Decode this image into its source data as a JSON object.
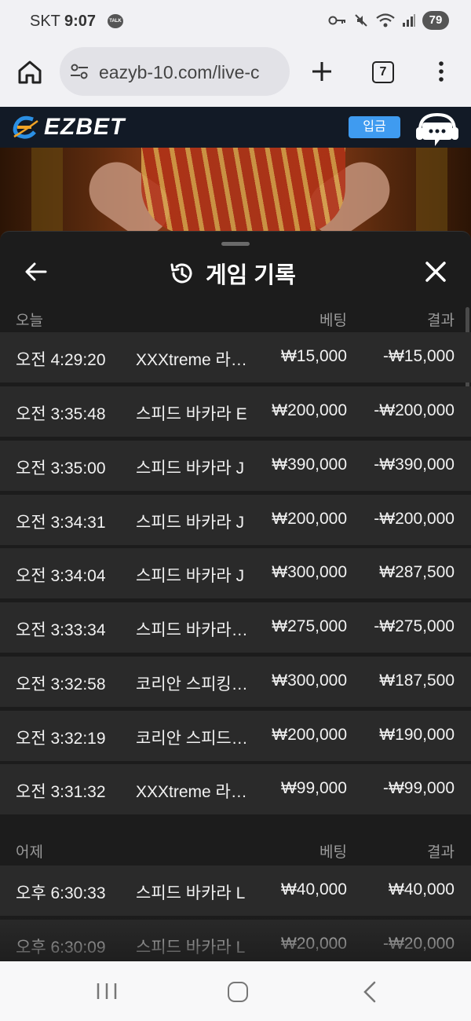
{
  "status_bar": {
    "carrier": "SKT",
    "time": "9:07",
    "talk_badge": "TALK",
    "battery": "79",
    "icons": [
      "key-icon",
      "mute-icon",
      "wifi-icon",
      "signal-icon",
      "battery-icon"
    ]
  },
  "browser": {
    "url": "eazyb-10.com/live-c",
    "tab_count": "7"
  },
  "site": {
    "logo_text": "EZBET",
    "deposit_label": "입금"
  },
  "panel": {
    "title": "게임 기록",
    "sections": [
      {
        "label": "오늘",
        "bet_header": "베팅",
        "result_header": "결과",
        "rows": [
          {
            "time": "오전 4:29:20",
            "game": "XXXtreme 라…",
            "bet": "₩15,000",
            "result": "-₩15,000"
          },
          {
            "time": "오전 3:35:48",
            "game": "스피드 바카라 E",
            "bet": "₩200,000",
            "result": "-₩200,000"
          },
          {
            "time": "오전 3:35:00",
            "game": "스피드 바카라 J",
            "bet": "₩390,000",
            "result": "-₩390,000"
          },
          {
            "time": "오전 3:34:31",
            "game": "스피드 바카라 J",
            "bet": "₩200,000",
            "result": "-₩200,000"
          },
          {
            "time": "오전 3:34:04",
            "game": "스피드 바카라 J",
            "bet": "₩300,000",
            "result": "₩287,500"
          },
          {
            "time": "오전 3:33:34",
            "game": "스피드 바카라…",
            "bet": "₩275,000",
            "result": "-₩275,000"
          },
          {
            "time": "오전 3:32:58",
            "game": "코리안 스피킹…",
            "bet": "₩300,000",
            "result": "₩187,500"
          },
          {
            "time": "오전 3:32:19",
            "game": "코리안 스피드…",
            "bet": "₩200,000",
            "result": "₩190,000"
          },
          {
            "time": "오전 3:31:32",
            "game": "XXXtreme 라…",
            "bet": "₩99,000",
            "result": "-₩99,000"
          }
        ]
      },
      {
        "label": "어제",
        "bet_header": "베팅",
        "result_header": "결과",
        "rows": [
          {
            "time": "오후 6:30:33",
            "game": "스피드 바카라 L",
            "bet": "₩40,000",
            "result": "₩40,000"
          },
          {
            "time": "오후 6:30:09",
            "game": "스피드 바카라 L",
            "bet": "₩20,000",
            "result": "-₩20,000"
          }
        ]
      }
    ]
  }
}
